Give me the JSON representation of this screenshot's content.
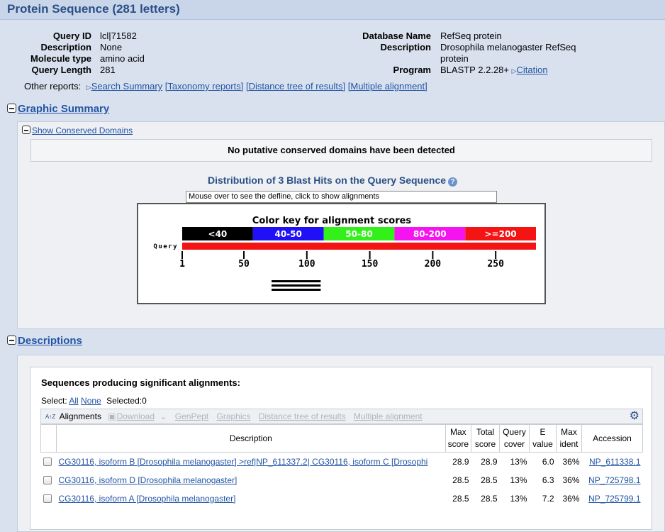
{
  "page": {
    "title": "Protein Sequence (281 letters)"
  },
  "query": {
    "left": [
      {
        "label": "Query ID",
        "value": "lcl|71582"
      },
      {
        "label": "Description",
        "value": "None"
      },
      {
        "label": "Molecule type",
        "value": "amino acid"
      },
      {
        "label": "Query Length",
        "value": "281"
      }
    ],
    "right": {
      "database_label": "Database Name",
      "database_value": "RefSeq protein",
      "description_label": "Description",
      "description_line1": "Drosophila melanogaster RefSeq",
      "description_line2": "protein",
      "program_label": "Program",
      "program_value": "BLASTP 2.2.28+",
      "citation": "Citation"
    }
  },
  "other_reports": {
    "label": "Other reports:",
    "links": [
      "Search Summary",
      "[Taxonomy reports]",
      "[Distance tree of results]",
      "[Multiple alignment]"
    ]
  },
  "graphic_summary": {
    "heading": "Graphic Summary",
    "show_domains": "Show Conserved Domains",
    "no_domains": "No putative conserved domains have been detected",
    "dist_title": "Distribution of 3 Blast Hits on the Query Sequence",
    "help_glyph": "?",
    "mouseover": "Mouse over to see the defline, click to show alignments",
    "color_key_title": "Color key for alignment scores",
    "color_key": [
      {
        "label": "<40",
        "color": "#000000"
      },
      {
        "label": "40-50",
        "color": "#1f10f5"
      },
      {
        "label": "50-80",
        "color": "#33f01a"
      },
      {
        "label": "80-200",
        "color": "#f514f0"
      },
      {
        "label": ">=200",
        "color": "#f51414"
      }
    ],
    "query_label": "Query",
    "query_length": 281,
    "query_bar_color": "#f51414",
    "ticks": [
      1,
      50,
      100,
      150,
      200,
      250
    ],
    "hits": [
      {
        "start": 72,
        "end": 111,
        "color": "#000000"
      },
      {
        "start": 72,
        "end": 111,
        "color": "#000000"
      },
      {
        "start": 72,
        "end": 111,
        "color": "#000000"
      }
    ]
  },
  "descriptions": {
    "heading": "Descriptions",
    "subtitle": "Sequences producing significant alignments:",
    "select_label": "Select:",
    "select_all": "All",
    "select_none": "None",
    "selected_text": "Selected:0",
    "toolbar": {
      "sort_icon_text": "A↑Z",
      "alignments": "Alignments",
      "download": "Download",
      "genpept": "GenPept",
      "graphics": "Graphics",
      "distance_tree": "Distance tree of results",
      "multiple_alignment": "Multiple alignment"
    },
    "columns": {
      "description": "Description",
      "max_score_1": "Max",
      "max_score_2": "score",
      "total_score_1": "Total",
      "total_score_2": "score",
      "query_cover_1": "Query",
      "query_cover_2": "cover",
      "evalue_1": "E",
      "evalue_2": "value",
      "max_ident_1": "Max",
      "max_ident_2": "ident",
      "accession": "Accession"
    },
    "rows": [
      {
        "description": "CG30116, isoform B [Drosophila melanogaster] >ref|NP_611337.2| CG30116, isoform C [Drosophi",
        "max_score": "28.9",
        "total_score": "28.9",
        "query_cover": "13%",
        "evalue": "6.0",
        "max_ident": "36%",
        "accession": "NP_611338.1"
      },
      {
        "description": "CG30116, isoform D [Drosophila melanogaster]",
        "max_score": "28.5",
        "total_score": "28.5",
        "query_cover": "13%",
        "evalue": "6.3",
        "max_ident": "36%",
        "accession": "NP_725798.1"
      },
      {
        "description": "CG30116, isoform A [Drosophila melanogaster]",
        "max_score": "28.5",
        "total_score": "28.5",
        "query_cover": "13%",
        "evalue": "7.2",
        "max_ident": "36%",
        "accession": "NP_725799.1"
      }
    ]
  }
}
